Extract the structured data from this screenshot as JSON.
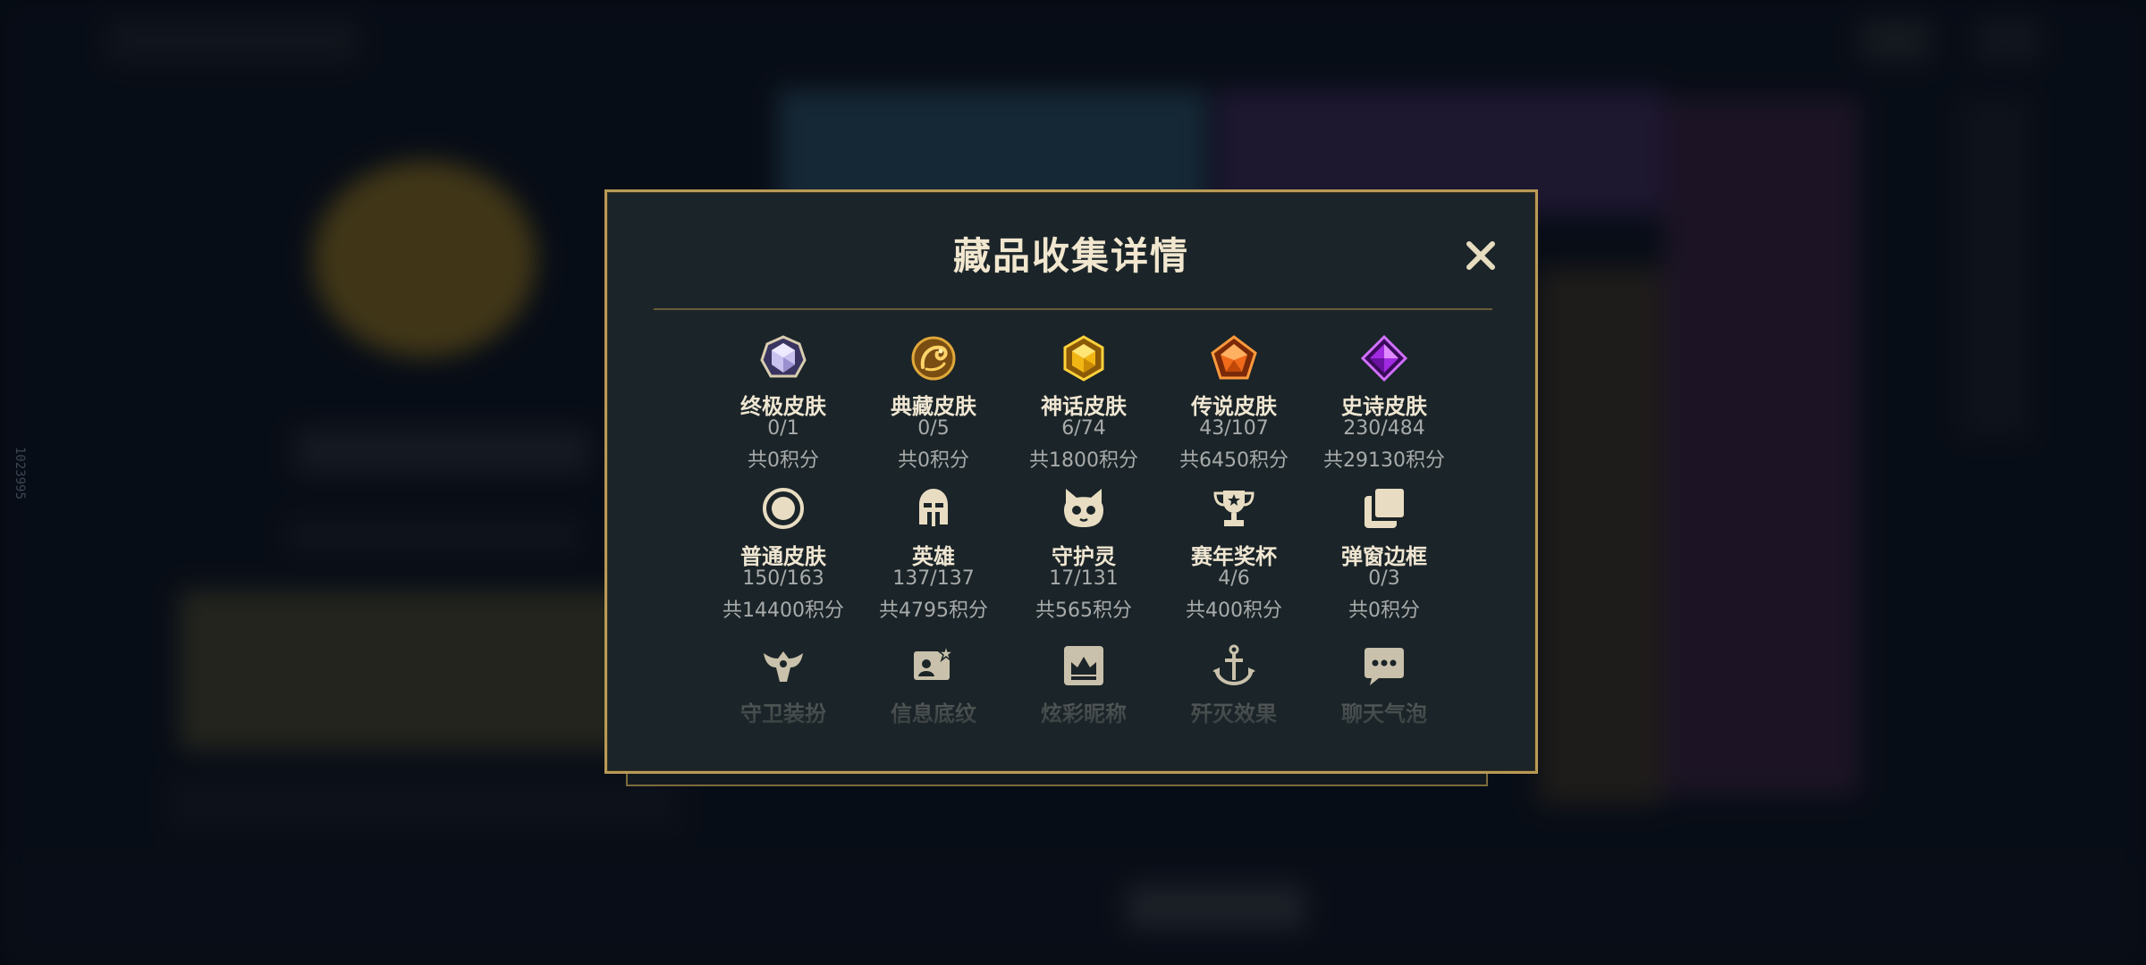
{
  "background_id": "1023995",
  "modal": {
    "title": "藏品收集详情",
    "close_label": "×"
  },
  "categories": [
    {
      "name": "终极皮肤",
      "count": "0/1",
      "points": "共0积分",
      "icon": "ultimate-skin-gem-icon"
    },
    {
      "name": "典藏皮肤",
      "count": "0/5",
      "points": "共0积分",
      "icon": "collector-dragon-icon"
    },
    {
      "name": "神话皮肤",
      "count": "6/74",
      "points": "共1800积分",
      "icon": "mythic-gem-icon"
    },
    {
      "name": "传说皮肤",
      "count": "43/107",
      "points": "共6450积分",
      "icon": "legendary-gem-icon"
    },
    {
      "name": "史诗皮肤",
      "count": "230/484",
      "points": "共29130积分",
      "icon": "epic-gem-icon"
    },
    {
      "name": "普通皮肤",
      "count": "150/163",
      "points": "共14400积分",
      "icon": "normal-skin-ring-icon"
    },
    {
      "name": "英雄",
      "count": "137/137",
      "points": "共4795积分",
      "icon": "champion-helmet-icon"
    },
    {
      "name": "守护灵",
      "count": "17/131",
      "points": "共565积分",
      "icon": "guardian-pet-icon"
    },
    {
      "name": "赛年奖杯",
      "count": "4/6",
      "points": "共400积分",
      "icon": "trophy-icon"
    },
    {
      "name": "弹窗边框",
      "count": "0/3",
      "points": "共0积分",
      "icon": "frame-stack-icon"
    },
    {
      "name": "守卫装扮",
      "icon": "ward-skin-icon"
    },
    {
      "name": "信息底纹",
      "icon": "profile-banner-icon"
    },
    {
      "name": "炫彩昵称",
      "icon": "nickname-crown-icon"
    },
    {
      "name": "歼灭效果",
      "icon": "elimination-effect-icon"
    },
    {
      "name": "聊天气泡",
      "icon": "chat-bubble-icon"
    }
  ],
  "colors": {
    "accent_gold": "#b89a57",
    "panel": "#1b2428",
    "title_text": "#f1e7cf",
    "muted_text": "#a8abaa"
  }
}
